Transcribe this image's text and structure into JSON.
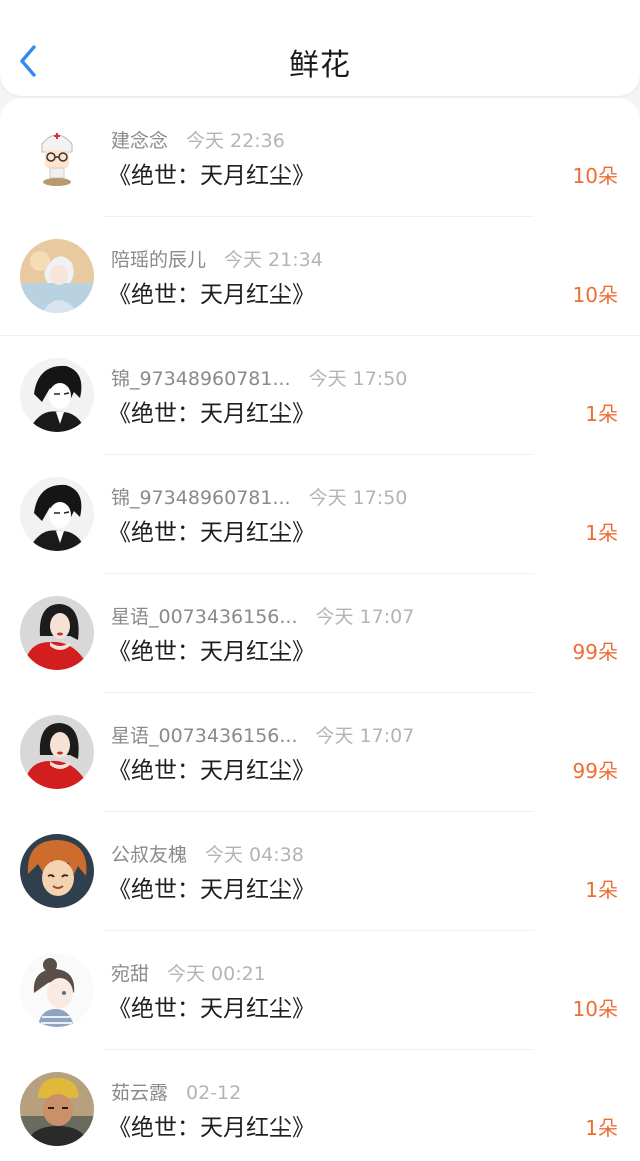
{
  "header": {
    "title": "鲜花",
    "back_icon": "chevron-left-icon",
    "accent_color": "#2f8cf3"
  },
  "count_color": "#ee6d33",
  "items": [
    {
      "name": "建念念",
      "time": "今天 22:36",
      "book": "《绝世：天月红尘》",
      "count": "10朵",
      "avatar": "nurse-cartoon"
    },
    {
      "name": "陪瑶的辰儿",
      "time": "今天 21:34",
      "book": "《绝世：天月红尘》",
      "count": "10朵",
      "avatar": "anime-white-hair"
    },
    {
      "name": "锦_97348960781...",
      "time": "今天 17:50",
      "book": "《绝世：天月红尘》",
      "count": "1朵",
      "avatar": "anime-dark-hair"
    },
    {
      "name": "锦_97348960781...",
      "time": "今天 17:50",
      "book": "《绝世：天月红尘》",
      "count": "1朵",
      "avatar": "anime-dark-hair"
    },
    {
      "name": "星语_0073436156...",
      "time": "今天 17:07",
      "book": "《绝世：天月红尘》",
      "count": "99朵",
      "avatar": "woman-red-dress"
    },
    {
      "name": "星语_0073436156...",
      "time": "今天 17:07",
      "book": "《绝世：天月红尘》",
      "count": "99朵",
      "avatar": "woman-red-dress"
    },
    {
      "name": "公叔友槐",
      "time": "今天 04:38",
      "book": "《绝世：天月红尘》",
      "count": "1朵",
      "avatar": "anime-orange-hair"
    },
    {
      "name": "宛甜",
      "time": "今天 00:21",
      "book": "《绝世：天月红尘》",
      "count": "10朵",
      "avatar": "anime-girl-bun"
    },
    {
      "name": "茹云露",
      "time": "02-12",
      "book": "《绝世：天月红尘》",
      "count": "1朵",
      "avatar": "photo-person-cap"
    }
  ]
}
